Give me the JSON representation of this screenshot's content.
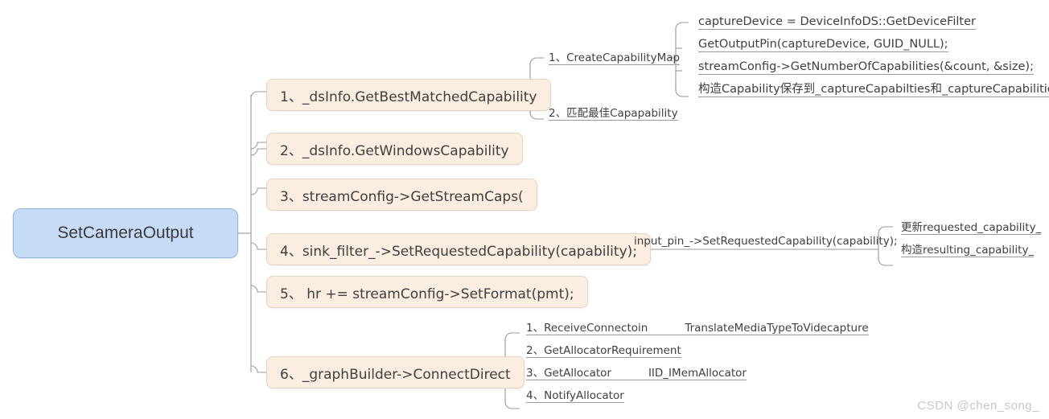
{
  "diagram": {
    "type": "mindmap",
    "title": "SetCameraOutput",
    "colors": {
      "root_fill": "#c6dbf5",
      "root_border": "#8fb6e0",
      "branch_fill": "#fbeee1",
      "branch_border": "#e3d5c4",
      "connector": "#9a9a9a",
      "text": "#3f3f3f",
      "watermark": "#c8c8c8"
    },
    "root": {
      "label": "SetCameraOutput"
    },
    "branches": [
      {
        "id": "b1",
        "label": "1、_dsInfo.GetBestMatchedCapability",
        "children": [
          {
            "id": "b1c1",
            "label": "1、CreateCapabilityMap",
            "children": [
              {
                "id": "b1c1g1",
                "label": "captureDevice = DeviceInfoDS::GetDeviceFilter"
              },
              {
                "id": "b1c1g2",
                "label": "GetOutputPin(captureDevice, GUID_NULL);"
              },
              {
                "id": "b1c1g3",
                "label": "streamConfig->GetNumberOfCapabilities(&count, &size);"
              },
              {
                "id": "b1c1g4",
                "label": "构造Capability保存到_captureCapabilties和_captureCapabilities中"
              }
            ]
          },
          {
            "id": "b1c2",
            "label": "2、匹配最佳Capapability",
            "children": []
          }
        ]
      },
      {
        "id": "b2",
        "label": "2、_dsInfo.GetWindowsCapability",
        "children": []
      },
      {
        "id": "b3",
        "label": "3、streamConfig->GetStreamCaps(",
        "children": []
      },
      {
        "id": "b4",
        "label": "4、sink_filter_->SetRequestedCapability(capability);",
        "children": [
          {
            "id": "b4c1",
            "label": "input_pin_->SetRequestedCapability(capability);",
            "children": [
              {
                "id": "b4c1g1",
                "label": "更新requested_capability_"
              },
              {
                "id": "b4c1g2",
                "label": "构造resulting_capability_"
              }
            ]
          }
        ]
      },
      {
        "id": "b5",
        "label": "5、    hr += streamConfig->SetFormat(pmt);",
        "children": []
      },
      {
        "id": "b6",
        "label": "6、_graphBuilder->ConnectDirect",
        "children": [
          {
            "id": "b6c1",
            "label": "1、ReceiveConnectoin",
            "note": "TranslateMediaTypeToVidecapture"
          },
          {
            "id": "b6c2",
            "label": "2、GetAllocatorRequirement",
            "note": ""
          },
          {
            "id": "b6c3",
            "label": "3、GetAllocator",
            "note": "IID_IMemAllocator"
          },
          {
            "id": "b6c4",
            "label": "4、NotifyAllocator",
            "note": ""
          }
        ]
      }
    ],
    "watermark": "CSDN @chen_song_"
  }
}
